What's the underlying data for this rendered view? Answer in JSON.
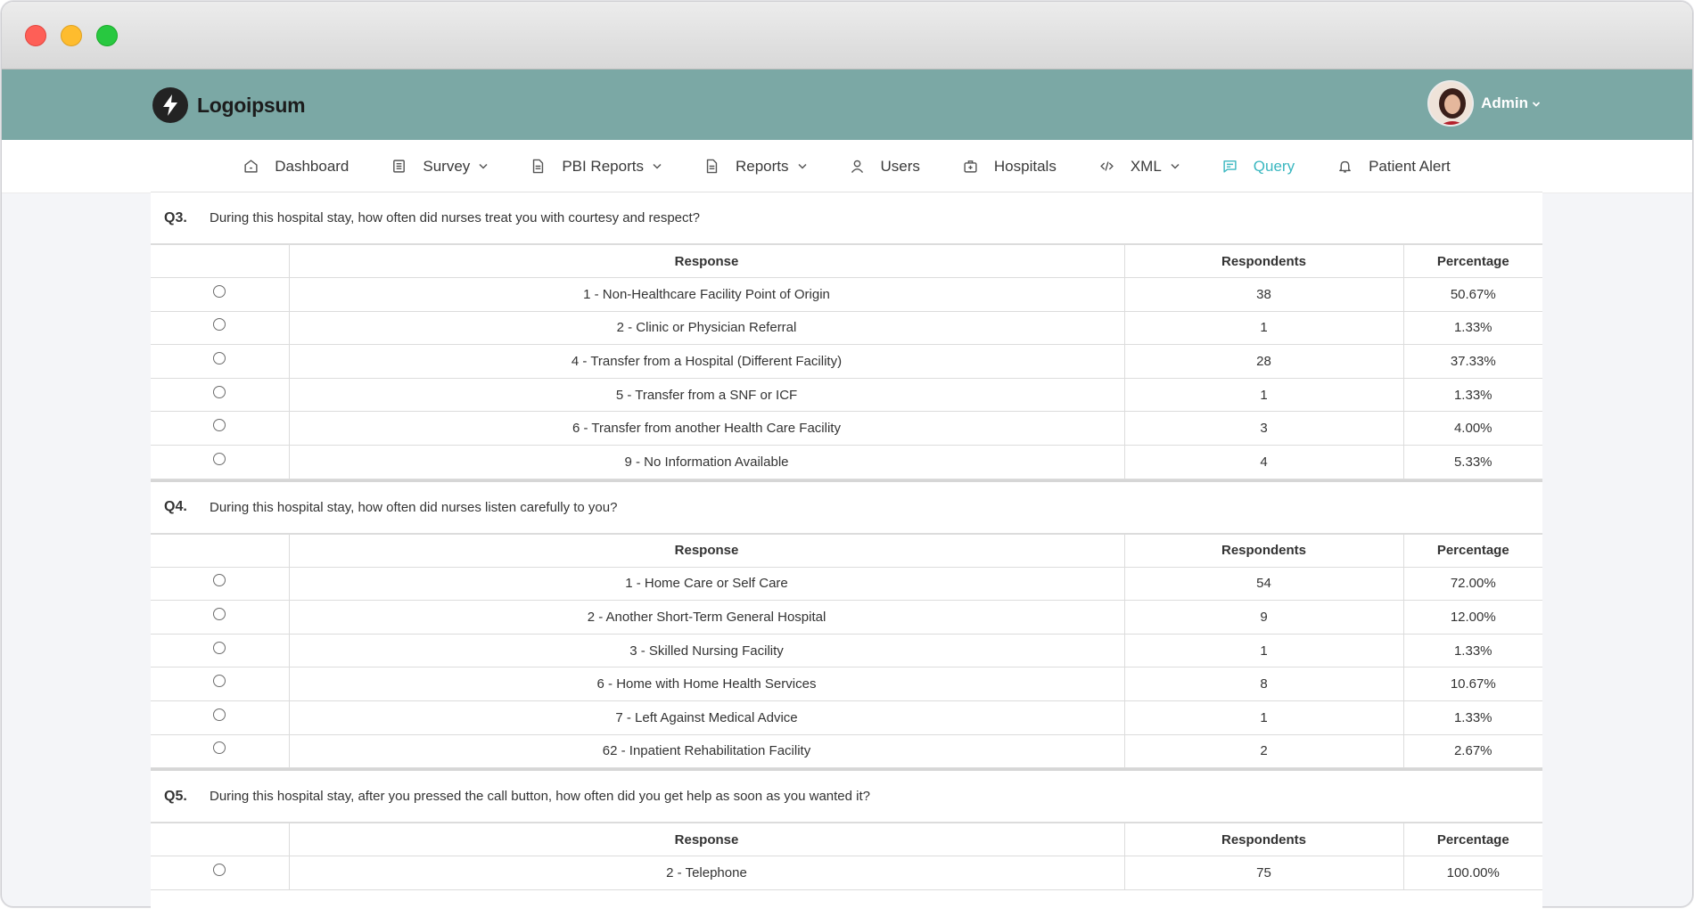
{
  "app": {
    "logo_text": "Logoipsum",
    "user_label": "Admin"
  },
  "nav": {
    "items": [
      {
        "label": "Dashboard",
        "icon": "home-icon",
        "dropdown": false,
        "active": false
      },
      {
        "label": "Survey",
        "icon": "list-icon",
        "dropdown": true,
        "active": false
      },
      {
        "label": "PBI Reports",
        "icon": "document-icon",
        "dropdown": true,
        "active": false
      },
      {
        "label": "Reports",
        "icon": "document-icon",
        "dropdown": true,
        "active": false
      },
      {
        "label": "Users",
        "icon": "user-icon",
        "dropdown": false,
        "active": false
      },
      {
        "label": "Hospitals",
        "icon": "hospital-icon",
        "dropdown": false,
        "active": false
      },
      {
        "label": "XML",
        "icon": "code-icon",
        "dropdown": true,
        "active": false
      },
      {
        "label": "Query",
        "icon": "chat-icon",
        "dropdown": false,
        "active": true
      },
      {
        "label": "Patient Alert",
        "icon": "bell-icon",
        "dropdown": false,
        "active": false
      }
    ],
    "active_color": "#3ab7c0"
  },
  "table_headers": {
    "response": "Response",
    "respondents": "Respondents",
    "percentage": "Percentage"
  },
  "questions": [
    {
      "number": "Q3.",
      "text": "During this hospital stay, how often did nurses treat you with courtesy and respect?",
      "rows": [
        {
          "response": "1 - Non-Healthcare Facility Point of Origin",
          "respondents": "38",
          "percentage": "50.67%"
        },
        {
          "response": "2 - Clinic or Physician Referral",
          "respondents": "1",
          "percentage": "1.33%"
        },
        {
          "response": "4 - Transfer from a Hospital (Different Facility)",
          "respondents": "28",
          "percentage": "37.33%"
        },
        {
          "response": "5 - Transfer from a SNF or ICF",
          "respondents": "1",
          "percentage": "1.33%"
        },
        {
          "response": "6 - Transfer from another Health Care Facility",
          "respondents": "3",
          "percentage": "4.00%"
        },
        {
          "response": "9 - No Information Available",
          "respondents": "4",
          "percentage": "5.33%"
        }
      ]
    },
    {
      "number": "Q4.",
      "text": "During this hospital stay, how often did nurses listen carefully to you?",
      "rows": [
        {
          "response": "1 - Home Care or Self Care",
          "respondents": "54",
          "percentage": "72.00%"
        },
        {
          "response": "2 - Another Short-Term General Hospital",
          "respondents": "9",
          "percentage": "12.00%"
        },
        {
          "response": "3 - Skilled Nursing Facility",
          "respondents": "1",
          "percentage": "1.33%"
        },
        {
          "response": "6 - Home with Home Health Services",
          "respondents": "8",
          "percentage": "10.67%"
        },
        {
          "response": "7 - Left Against Medical Advice",
          "respondents": "1",
          "percentage": "1.33%"
        },
        {
          "response": "62 - Inpatient Rehabilitation Facility",
          "respondents": "2",
          "percentage": "2.67%"
        }
      ]
    },
    {
      "number": "Q5.",
      "text": "During this hospital stay, after you pressed the call button, how often did you get help as soon as you wanted it?",
      "rows": [
        {
          "response": "2 - Telephone",
          "respondents": "75",
          "percentage": "100.00%"
        }
      ]
    }
  ]
}
